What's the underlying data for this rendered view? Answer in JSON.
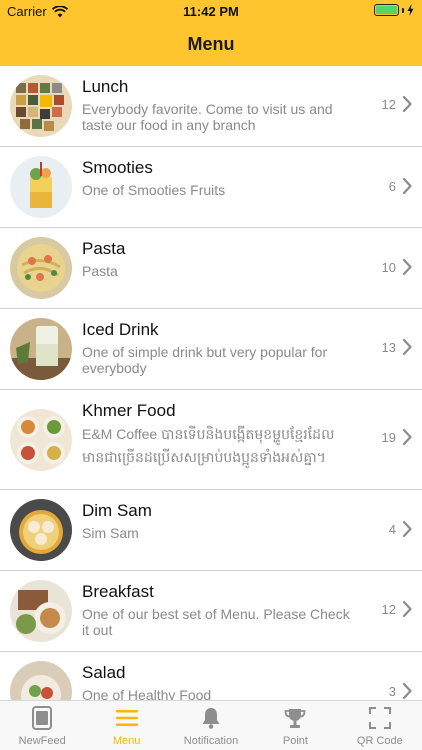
{
  "status_bar": {
    "carrier": "Carrier",
    "time": "11:42 PM"
  },
  "nav": {
    "title": "Menu"
  },
  "colors": {
    "brand": "#FEC52E",
    "active_tab": "#F5B800",
    "battery": "#4CD964"
  },
  "menu": {
    "items": [
      {
        "name": "Lunch",
        "description": "Everybody favorite. Come to visit us and taste our food in any branch",
        "count": "12",
        "thumbnail": "lunch-thumbnail"
      },
      {
        "name": "Smooties",
        "description": "One of Smooties Fruits",
        "count": "6",
        "thumbnail": "smoothie-thumbnail"
      },
      {
        "name": "Pasta",
        "description": "Pasta",
        "count": "10",
        "thumbnail": "pasta-thumbnail"
      },
      {
        "name": "Iced Drink",
        "description": "One of simple drink but very popular for everybody",
        "count": "13",
        "thumbnail": "iced-drink-thumbnail"
      },
      {
        "name": "Khmer Food",
        "description": "E&M Coffee បានទើបនិងបង្កើតមុខម្ហូបខ្មែរដែលមានជាច្រើនដប្រើសសម្រាប់បងប្អូនទាំងអស់គ្នា។",
        "count": "19",
        "thumbnail": "khmer-food-thumbnail"
      },
      {
        "name": "Dim Sam",
        "description": "Sim Sam",
        "count": "4",
        "thumbnail": "dim-sum-thumbnail"
      },
      {
        "name": "Breakfast",
        "description": "One of our best set of Menu. Please Check it out",
        "count": "12",
        "thumbnail": "breakfast-thumbnail"
      },
      {
        "name": "Salad",
        "description": "One of Healthy Food",
        "count": "3",
        "thumbnail": "salad-thumbnail"
      }
    ]
  },
  "tabbar": {
    "tabs": [
      {
        "label": "NewFeed",
        "icon": "newfeed-icon",
        "active": false
      },
      {
        "label": "Menu",
        "icon": "menu-icon",
        "active": true
      },
      {
        "label": "Notification",
        "icon": "bell-icon",
        "active": false
      },
      {
        "label": "Point",
        "icon": "trophy-icon",
        "active": false
      },
      {
        "label": "QR Code",
        "icon": "qr-scan-icon",
        "active": false
      }
    ]
  }
}
